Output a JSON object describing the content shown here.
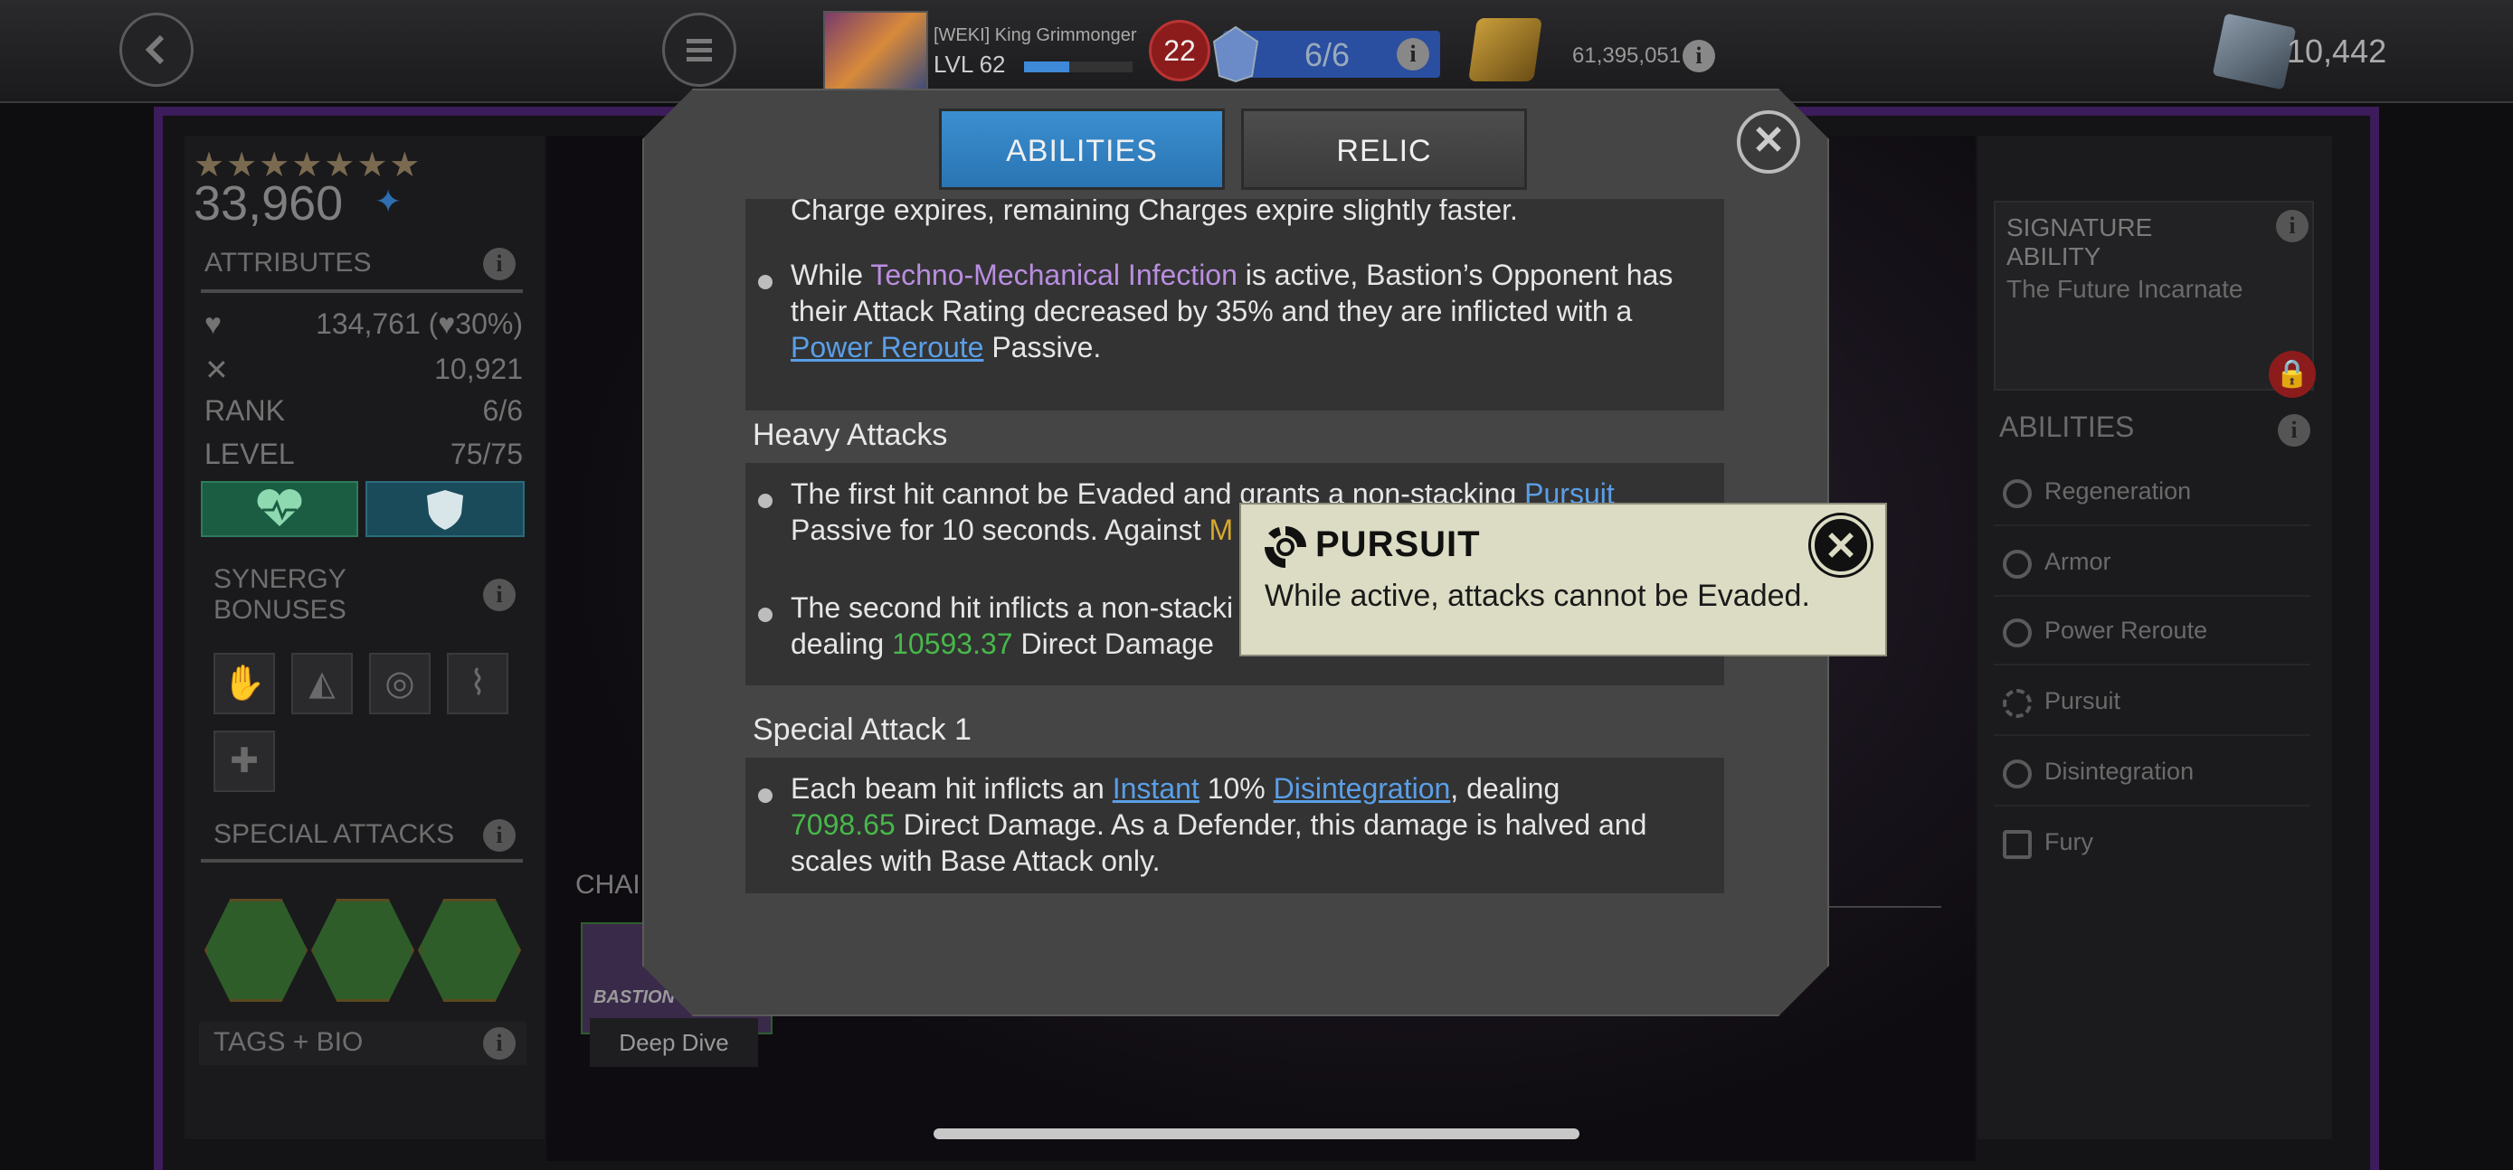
{
  "topbar": {
    "player_name": "[WEKI] King Grimmonger",
    "player_level": "LVL 62",
    "xp_fraction": 0.42,
    "level_badge": "22",
    "energy": "6/6",
    "gold": "61,395,051",
    "units": "10,442"
  },
  "left": {
    "stars": "★★★★★★★",
    "rating": "33,960",
    "attributes_title": "ATTRIBUTES",
    "health": "134,761",
    "health_pct": "(♥30%)",
    "attack": "10,921",
    "rank_label": "RANK",
    "rank_value": "6/6",
    "level_label": "LEVEL",
    "level_value": "75/75",
    "synergy_title": "SYNERGY BONUSES",
    "special_attacks_title": "SPECIAL ATTACKS",
    "tags_title": "TAGS + BIO"
  },
  "center": {
    "champ_label": "CHAI",
    "champ_card_text": "BASTION",
    "deep_dive": "Deep Dive"
  },
  "right": {
    "sig_title": "SIGNATURE ABILITY",
    "sig_name": "The Future Incarnate",
    "abilities_title": "ABILITIES",
    "abilities": [
      "Regeneration",
      "Armor",
      "Power Reroute",
      "Pursuit",
      "Disintegration",
      "Fury"
    ]
  },
  "modal": {
    "tab_abilities": "ABILITIES",
    "tab_relic": "RELIC",
    "partial_line": "Charge expires, remaining Charges expire slightly faster.",
    "p1_a": "While ",
    "p1_term": "Techno-Mechanical Infection",
    "p1_b": " is active, Bastion’s Opponent has their Attack Rating decreased by 35% and they are inflicted with a ",
    "p1_link": "Power Reroute",
    "p1_c": " Passive.",
    "heavy_heading": "Heavy Attacks",
    "h1_a": "The first hit cannot be Evaded and grants a non-stacking ",
    "h1_link": "Pursuit",
    "h1_b": " Passive for 10 seconds. Against ",
    "h1_gold": "M",
    "h2_a": "The second hit inflicts a non-stacki",
    "h2_b": "dealing ",
    "h2_num": "10593.37",
    "h2_c": " Direct Damage",
    "sp1_heading": "Special Attack 1",
    "s1_a": "Each beam hit inflicts an ",
    "s1_link1": "Instant",
    "s1_b": " 10% ",
    "s1_link2": "Disintegration",
    "s1_c": ", dealing",
    "s1_num": "7098.65",
    "s1_d": " Direct Damage. As a Defender, this damage is halved and scales with Base Attack only."
  },
  "tooltip": {
    "title": "PURSUIT",
    "description": "While active, attacks cannot be Evaded."
  },
  "colors": {
    "tab_active": "#2a74b3",
    "link": "#5a9fe8",
    "term_purple": "#b98ee0",
    "damage_green": "#47b84a",
    "tooltip_bg": "#dcdcc4"
  }
}
